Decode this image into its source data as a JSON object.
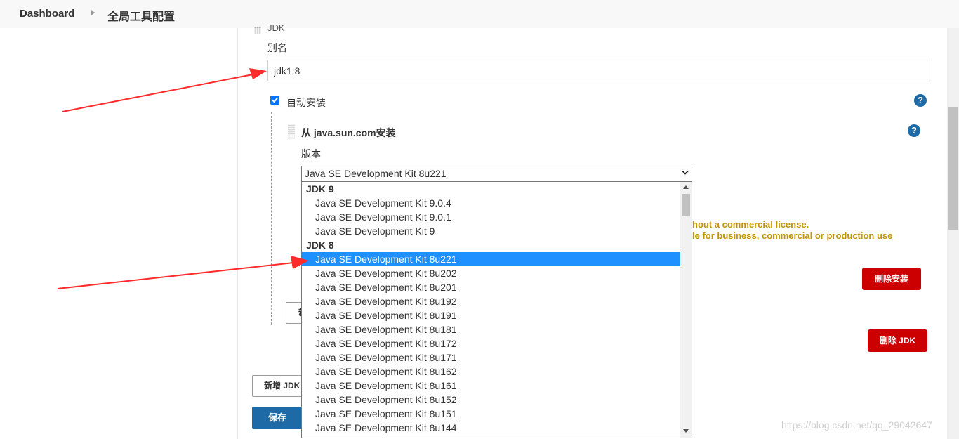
{
  "breadcrumb": {
    "home": "Dashboard",
    "page": "全局工具配置"
  },
  "jdk_section": {
    "header": "JDK",
    "alias_label": "别名",
    "alias_value": "jdk1.8",
    "auto_install_label": "自动安装",
    "auto_install_checked": true,
    "installer_title": "从 java.sun.com安装",
    "version_label": "版本",
    "selected_version": "Java SE Development Kit 8u221",
    "warning_line1": "hout a commercial license.",
    "warning_line2": "le for business, commercial or production use",
    "delete_installer_label": "删除安装",
    "delete_jdk_label": "删除 JDK",
    "add_installer_partial": "新",
    "help_icon_text": "?"
  },
  "dropdown": {
    "groups": [
      {
        "label": "JDK 9",
        "options": [
          "Java SE Development Kit 9.0.4",
          "Java SE Development Kit 9.0.1",
          "Java SE Development Kit 9"
        ]
      },
      {
        "label": "JDK 8",
        "options": [
          "Java SE Development Kit 8u221",
          "Java SE Development Kit 8u202",
          "Java SE Development Kit 8u201",
          "Java SE Development Kit 8u192",
          "Java SE Development Kit 8u191",
          "Java SE Development Kit 8u181",
          "Java SE Development Kit 8u172",
          "Java SE Development Kit 8u171",
          "Java SE Development Kit 8u162",
          "Java SE Development Kit 8u161",
          "Java SE Development Kit 8u152",
          "Java SE Development Kit 8u151",
          "Java SE Development Kit 8u144"
        ]
      }
    ],
    "highlighted": "Java SE Development Kit 8u221"
  },
  "footer": {
    "add_jdk_label": "新增 JDK",
    "save_label": "保存"
  },
  "watermark": "https://blog.csdn.net/qq_29042647",
  "colors": {
    "accent_blue": "#1e6aa6",
    "danger_red": "#cc0000",
    "warning": "#c29400",
    "selection": "#1e90ff",
    "annotation_arrow": "#ff2a2a"
  }
}
